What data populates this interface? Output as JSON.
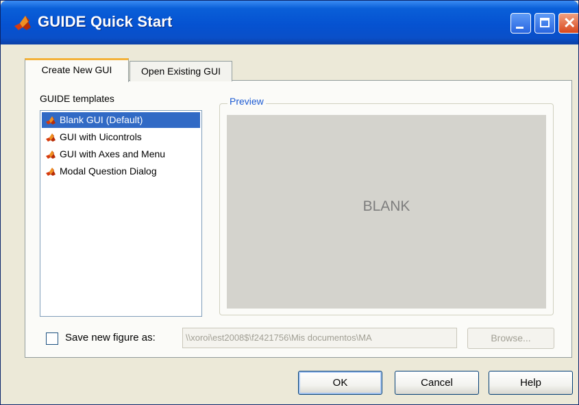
{
  "window": {
    "title": "GUIDE Quick Start",
    "icon": "matlab-logo-icon",
    "controls": [
      "minimize-icon",
      "maximize-icon",
      "close-icon"
    ]
  },
  "tabs": [
    {
      "label": "Create New GUI",
      "active": true
    },
    {
      "label": "Open Existing GUI",
      "active": false
    }
  ],
  "templates": {
    "label": "GUIDE templates",
    "items": [
      {
        "label": "Blank GUI (Default)",
        "selected": true
      },
      {
        "label": "GUI with Uicontrols",
        "selected": false
      },
      {
        "label": "GUI with Axes and Menu",
        "selected": false
      },
      {
        "label": "Modal Question Dialog",
        "selected": false
      }
    ]
  },
  "preview": {
    "legend": "Preview",
    "text": "BLANK"
  },
  "save": {
    "checkbox_label": "Save new figure as:",
    "checked": false,
    "path": "\\\\xoroi\\est2008$\\f2421756\\Mis documentos\\MA",
    "browse_label": "Browse..."
  },
  "buttons": {
    "ok": "OK",
    "cancel": "Cancel",
    "help": "Help"
  },
  "colors": {
    "titlebar": "#0552d1",
    "selection": "#316ac5",
    "preview_legend": "#1d5bd3",
    "tab_highlight": "#f4b23a"
  }
}
